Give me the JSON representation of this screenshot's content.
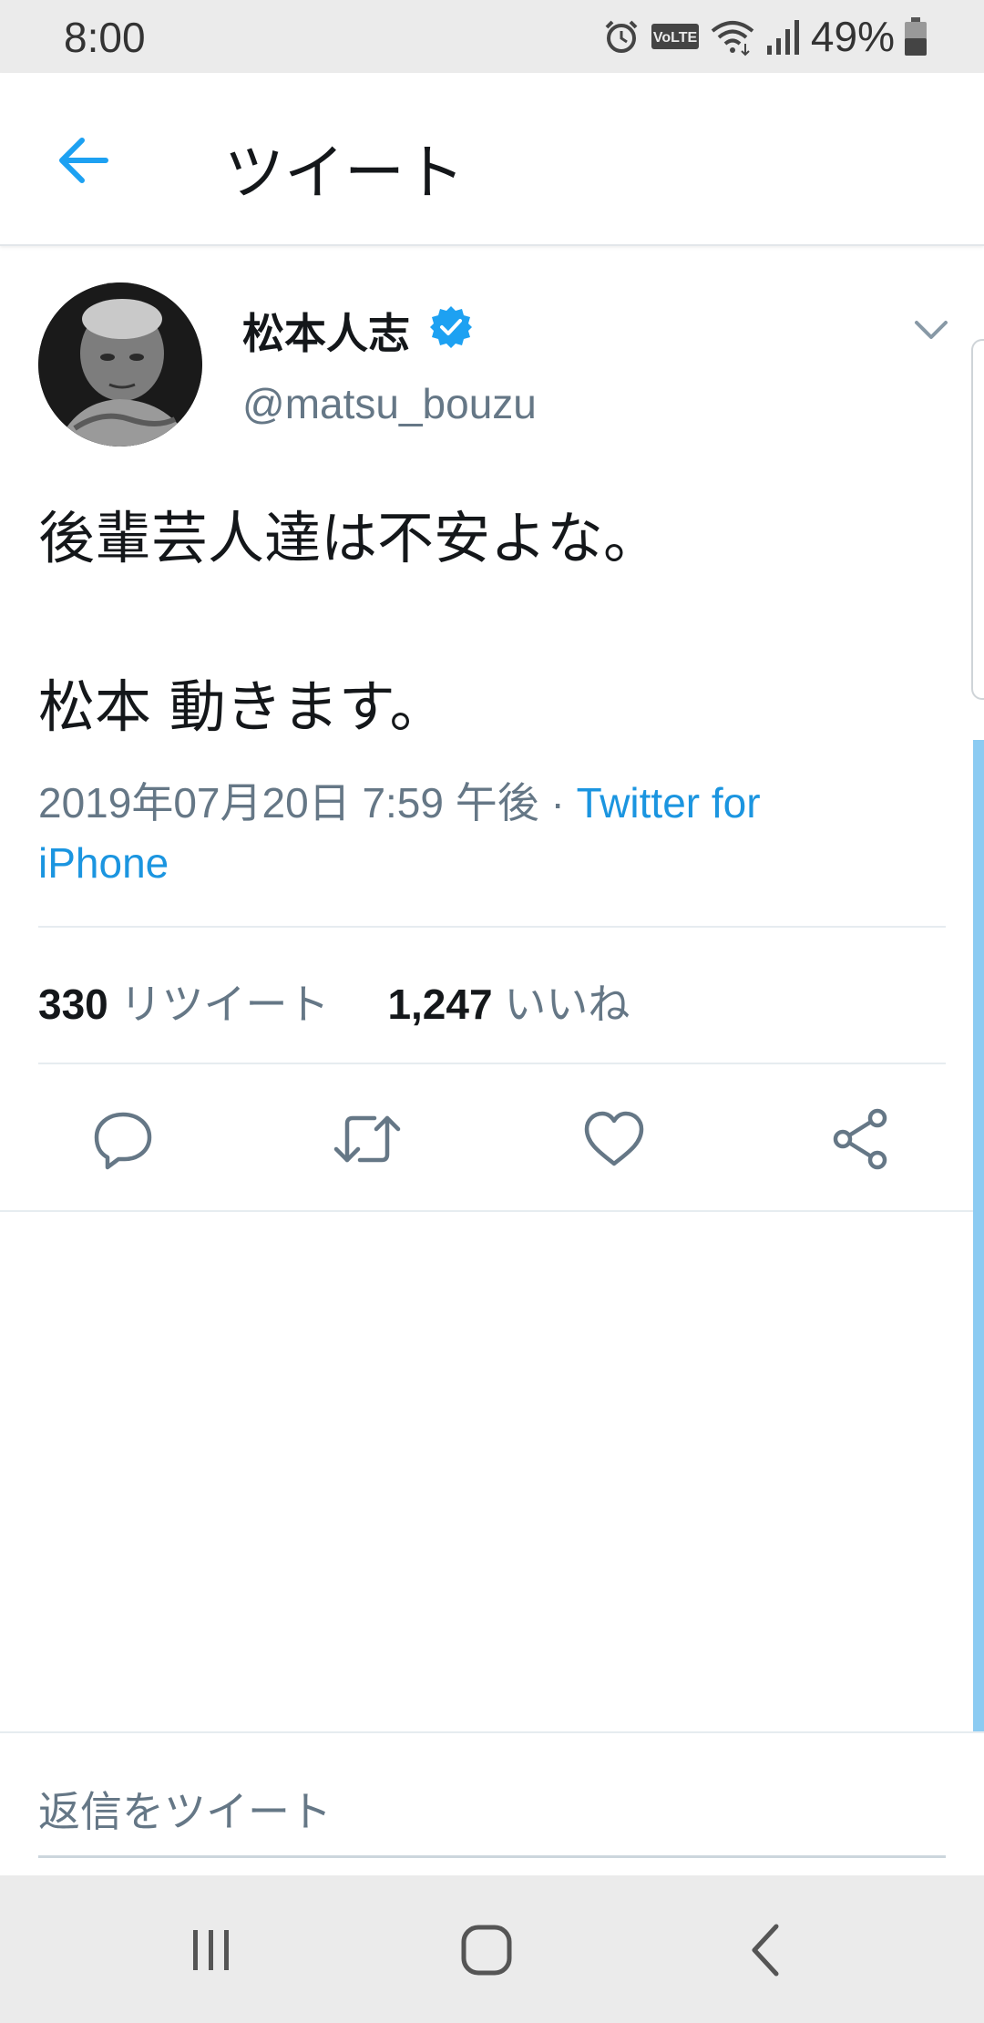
{
  "status_bar": {
    "time": "8:00",
    "volte_label": "VoLTE",
    "battery_percent": "49%",
    "icons": [
      "alarm-icon",
      "volte-icon",
      "wifi-icon",
      "signal-icon",
      "battery-icon"
    ]
  },
  "header": {
    "back_icon": "arrow-left-icon",
    "title": "ツイート"
  },
  "tweet": {
    "author_name": "松本人志",
    "verified": true,
    "author_handle": "@matsu_bouzu",
    "text_line1": "後輩芸人達は不安よな。",
    "text_line2": "松本 動きます。",
    "timestamp": "2019年07月20日 7:59 午後",
    "separator": " · ",
    "source": "Twitter for iPhone",
    "retweet_count": "330",
    "retweet_label": "リツイート",
    "like_count": "1,247",
    "like_label": "いいね",
    "actions": [
      "reply-icon",
      "retweet-icon",
      "like-icon",
      "share-icon"
    ]
  },
  "reply": {
    "placeholder": "返信をツイート"
  },
  "nav_bar": {
    "buttons": [
      "recent-apps-icon",
      "home-icon",
      "back-icon"
    ]
  },
  "colors": {
    "accent": "#1da1f2",
    "link": "#1b95e0",
    "secondary_text": "#657786",
    "primary_text": "#14171a",
    "system_bar": "#ebebeb"
  }
}
